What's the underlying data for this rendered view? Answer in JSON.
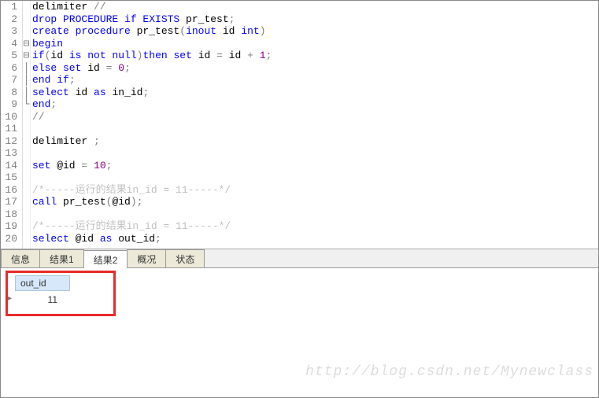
{
  "code": {
    "lines": [
      {
        "n": "1",
        "f": " ",
        "seg": [
          {
            "c": "txt",
            "t": "delimiter "
          },
          {
            "c": "op",
            "t": "//"
          }
        ]
      },
      {
        "n": "2",
        "f": " ",
        "seg": [
          {
            "c": "kw",
            "t": "drop PROCEDURE if EXISTS"
          },
          {
            "c": "txt",
            "t": " pr_test"
          },
          {
            "c": "op",
            "t": ";"
          }
        ]
      },
      {
        "n": "3",
        "f": " ",
        "seg": [
          {
            "c": "kw",
            "t": "create procedure"
          },
          {
            "c": "txt",
            "t": " pr_test"
          },
          {
            "c": "op",
            "t": "("
          },
          {
            "c": "kw",
            "t": "inout"
          },
          {
            "c": "txt",
            "t": " id "
          },
          {
            "c": "kw",
            "t": "int"
          },
          {
            "c": "op",
            "t": ")"
          }
        ]
      },
      {
        "n": "4",
        "f": "⊟",
        "seg": [
          {
            "c": "kw",
            "t": "begin"
          }
        ]
      },
      {
        "n": "5",
        "f": "⊟",
        "seg": [
          {
            "c": "kw",
            "t": "if"
          },
          {
            "c": "op",
            "t": "("
          },
          {
            "c": "txt",
            "t": "id "
          },
          {
            "c": "kw",
            "t": "is not null"
          },
          {
            "c": "op",
            "t": ")"
          },
          {
            "c": "kw",
            "t": "then set"
          },
          {
            "c": "txt",
            "t": " id "
          },
          {
            "c": "op",
            "t": "="
          },
          {
            "c": "txt",
            "t": " id "
          },
          {
            "c": "op",
            "t": "+ "
          },
          {
            "c": "kw2",
            "t": "1"
          },
          {
            "c": "op",
            "t": ";"
          }
        ]
      },
      {
        "n": "6",
        "f": "│",
        "seg": [
          {
            "c": "kw",
            "t": "else set"
          },
          {
            "c": "txt",
            "t": " id "
          },
          {
            "c": "op",
            "t": "= "
          },
          {
            "c": "kw2",
            "t": "0"
          },
          {
            "c": "op",
            "t": ";"
          }
        ]
      },
      {
        "n": "7",
        "f": "│",
        "seg": [
          {
            "c": "kw",
            "t": "end if"
          },
          {
            "c": "op",
            "t": ";"
          }
        ]
      },
      {
        "n": "8",
        "f": "│",
        "seg": [
          {
            "c": "kw",
            "t": "select"
          },
          {
            "c": "txt",
            "t": " id "
          },
          {
            "c": "kw",
            "t": "as"
          },
          {
            "c": "txt",
            "t": " in_id"
          },
          {
            "c": "op",
            "t": ";"
          }
        ]
      },
      {
        "n": "9",
        "f": "└",
        "seg": [
          {
            "c": "kw",
            "t": "end"
          },
          {
            "c": "op",
            "t": ";"
          }
        ]
      },
      {
        "n": "10",
        "f": " ",
        "seg": [
          {
            "c": "op",
            "t": "//"
          }
        ]
      },
      {
        "n": "11",
        "f": " ",
        "seg": []
      },
      {
        "n": "12",
        "f": " ",
        "seg": [
          {
            "c": "txt",
            "t": "delimiter "
          },
          {
            "c": "op",
            "t": ";"
          }
        ]
      },
      {
        "n": "13",
        "f": " ",
        "seg": []
      },
      {
        "n": "14",
        "f": " ",
        "seg": [
          {
            "c": "kw",
            "t": "set"
          },
          {
            "c": "txt",
            "t": " @id "
          },
          {
            "c": "op",
            "t": "= "
          },
          {
            "c": "kw2",
            "t": "10"
          },
          {
            "c": "op",
            "t": ";"
          }
        ]
      },
      {
        "n": "15",
        "f": " ",
        "seg": []
      },
      {
        "n": "16",
        "f": " ",
        "seg": [
          {
            "c": "cmt",
            "t": "/*-----运行的结果in_id = 11-----*/"
          }
        ]
      },
      {
        "n": "17",
        "f": " ",
        "seg": [
          {
            "c": "kw",
            "t": "call"
          },
          {
            "c": "txt",
            "t": " pr_test"
          },
          {
            "c": "op",
            "t": "("
          },
          {
            "c": "txt",
            "t": "@id"
          },
          {
            "c": "op",
            "t": ");"
          }
        ]
      },
      {
        "n": "18",
        "f": " ",
        "seg": []
      },
      {
        "n": "19",
        "f": " ",
        "seg": [
          {
            "c": "cmt",
            "t": "/*-----运行的结果in_id = 11-----*/"
          }
        ]
      },
      {
        "n": "20",
        "f": " ",
        "seg": [
          {
            "c": "kw",
            "t": "select"
          },
          {
            "c": "txt",
            "t": " @id "
          },
          {
            "c": "kw",
            "t": "as"
          },
          {
            "c": "txt",
            "t": " out_id"
          },
          {
            "c": "op",
            "t": ";"
          }
        ]
      }
    ]
  },
  "tabs": [
    {
      "label": "信息",
      "active": false
    },
    {
      "label": "结果1",
      "active": false
    },
    {
      "label": "结果2",
      "active": true
    },
    {
      "label": "概况",
      "active": false
    },
    {
      "label": "状态",
      "active": false
    }
  ],
  "result": {
    "columns": [
      "out_id"
    ],
    "rows": [
      [
        "11"
      ]
    ]
  },
  "watermark": "http://blog.csdn.net/Mynewclass"
}
